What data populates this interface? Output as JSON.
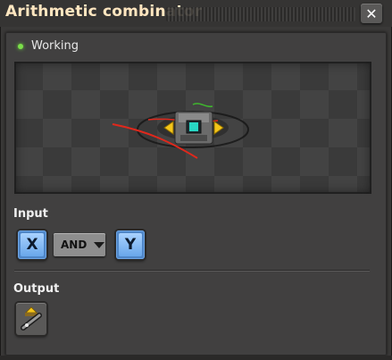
{
  "window": {
    "title": "Arithmetic combinator",
    "close_glyph": "✕"
  },
  "status": {
    "label": "Working",
    "color": "#7be04a"
  },
  "preview": {
    "icon": "arithmetic-combinator-entity"
  },
  "input": {
    "label": "Input",
    "left_signal": "X",
    "operator": "AND",
    "right_signal": "Y"
  },
  "output": {
    "label": "Output",
    "icon": "arithmetic-combinator-item-icon"
  },
  "colors": {
    "title_text": "#ffe6c0",
    "signal_button": "#69a7ea",
    "panel_bg": "#414040"
  }
}
